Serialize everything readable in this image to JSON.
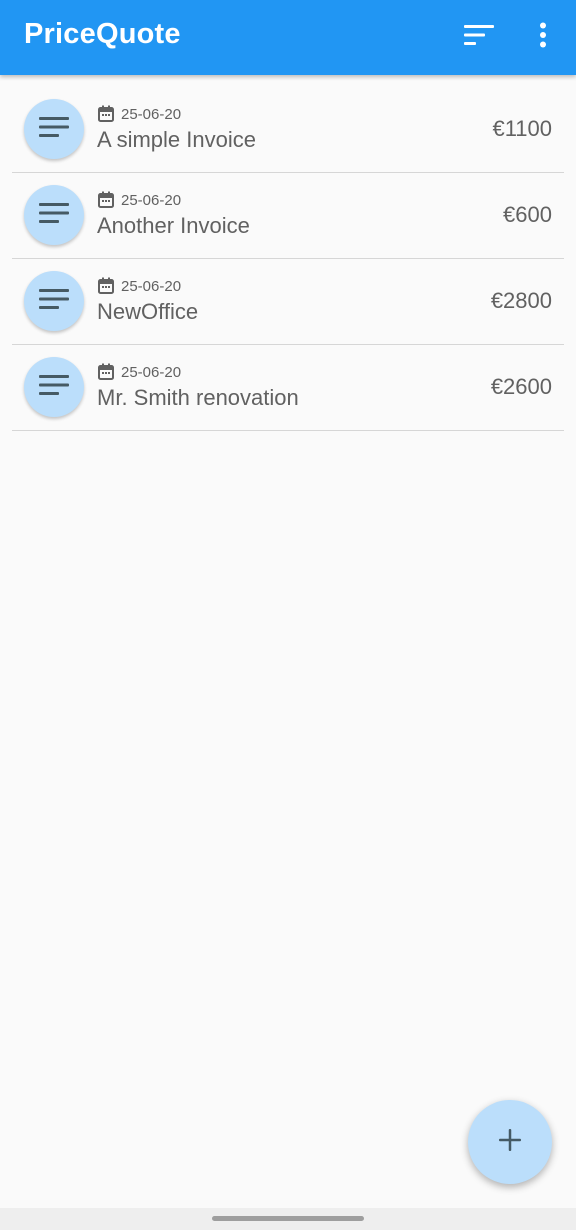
{
  "app": {
    "title": "PriceQuote",
    "accent_color": "#2196f3",
    "avatar_color": "#bbdefb"
  },
  "toolbar": {
    "actions": [
      {
        "icon": "sort-icon"
      },
      {
        "icon": "more-vert-icon"
      }
    ]
  },
  "invoices": [
    {
      "date": "25-06-20",
      "title": "A simple Invoice",
      "amount": "€1100",
      "icon": "notes-icon"
    },
    {
      "date": "25-06-20",
      "title": "Another Invoice",
      "amount": "€600",
      "icon": "notes-icon"
    },
    {
      "date": "25-06-20",
      "title": "NewOffice",
      "amount": "€2800",
      "icon": "notes-icon"
    },
    {
      "date": "25-06-20",
      "title": "Mr. Smith renovation",
      "amount": "€2600",
      "icon": "notes-icon"
    }
  ],
  "fab": {
    "icon": "add-icon"
  }
}
